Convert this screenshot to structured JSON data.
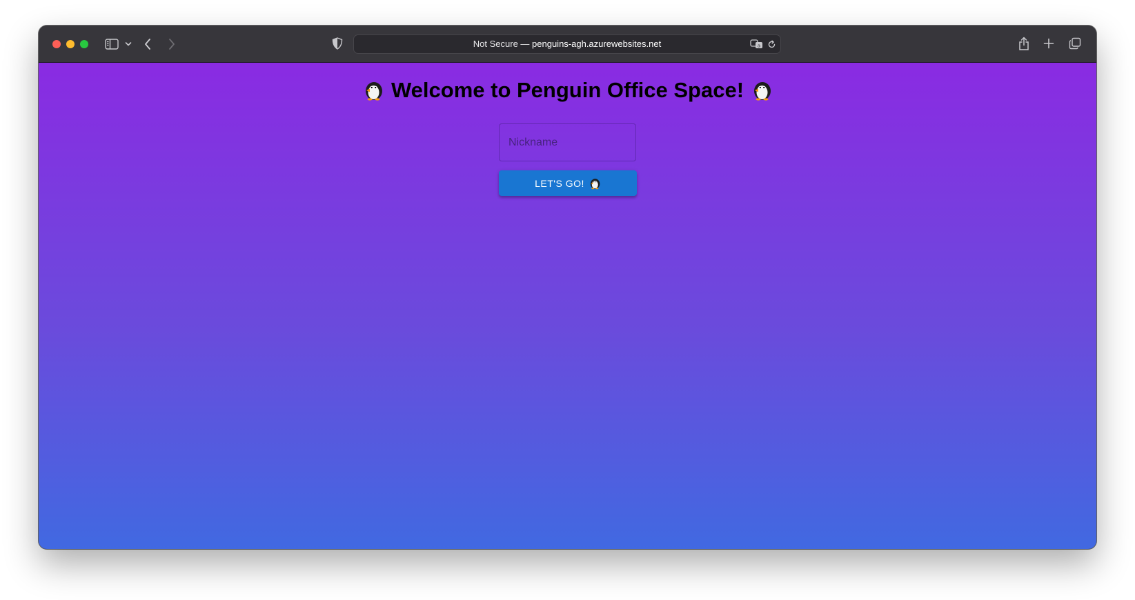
{
  "browser": {
    "address_prefix": "Not Secure — ",
    "address_domain": "penguins-agh.azurewebsites.net",
    "icons": [
      "sidebar-icon",
      "chevron-down-icon",
      "back-arrow-icon",
      "forward-arrow-icon",
      "shield-icon",
      "translate-icon",
      "reload-icon",
      "share-icon",
      "plus-icon",
      "tabs-overview-icon"
    ]
  },
  "page": {
    "title": "Welcome to Penguin Office Space!",
    "title_emoji": "penguin-icon",
    "nickname_placeholder": "Nickname",
    "nickname_value": "",
    "go_button_label": "LET'S GO!",
    "background_top": "#8a2be2",
    "background_bottom": "#4169e1",
    "button_color": "#1976d2"
  }
}
